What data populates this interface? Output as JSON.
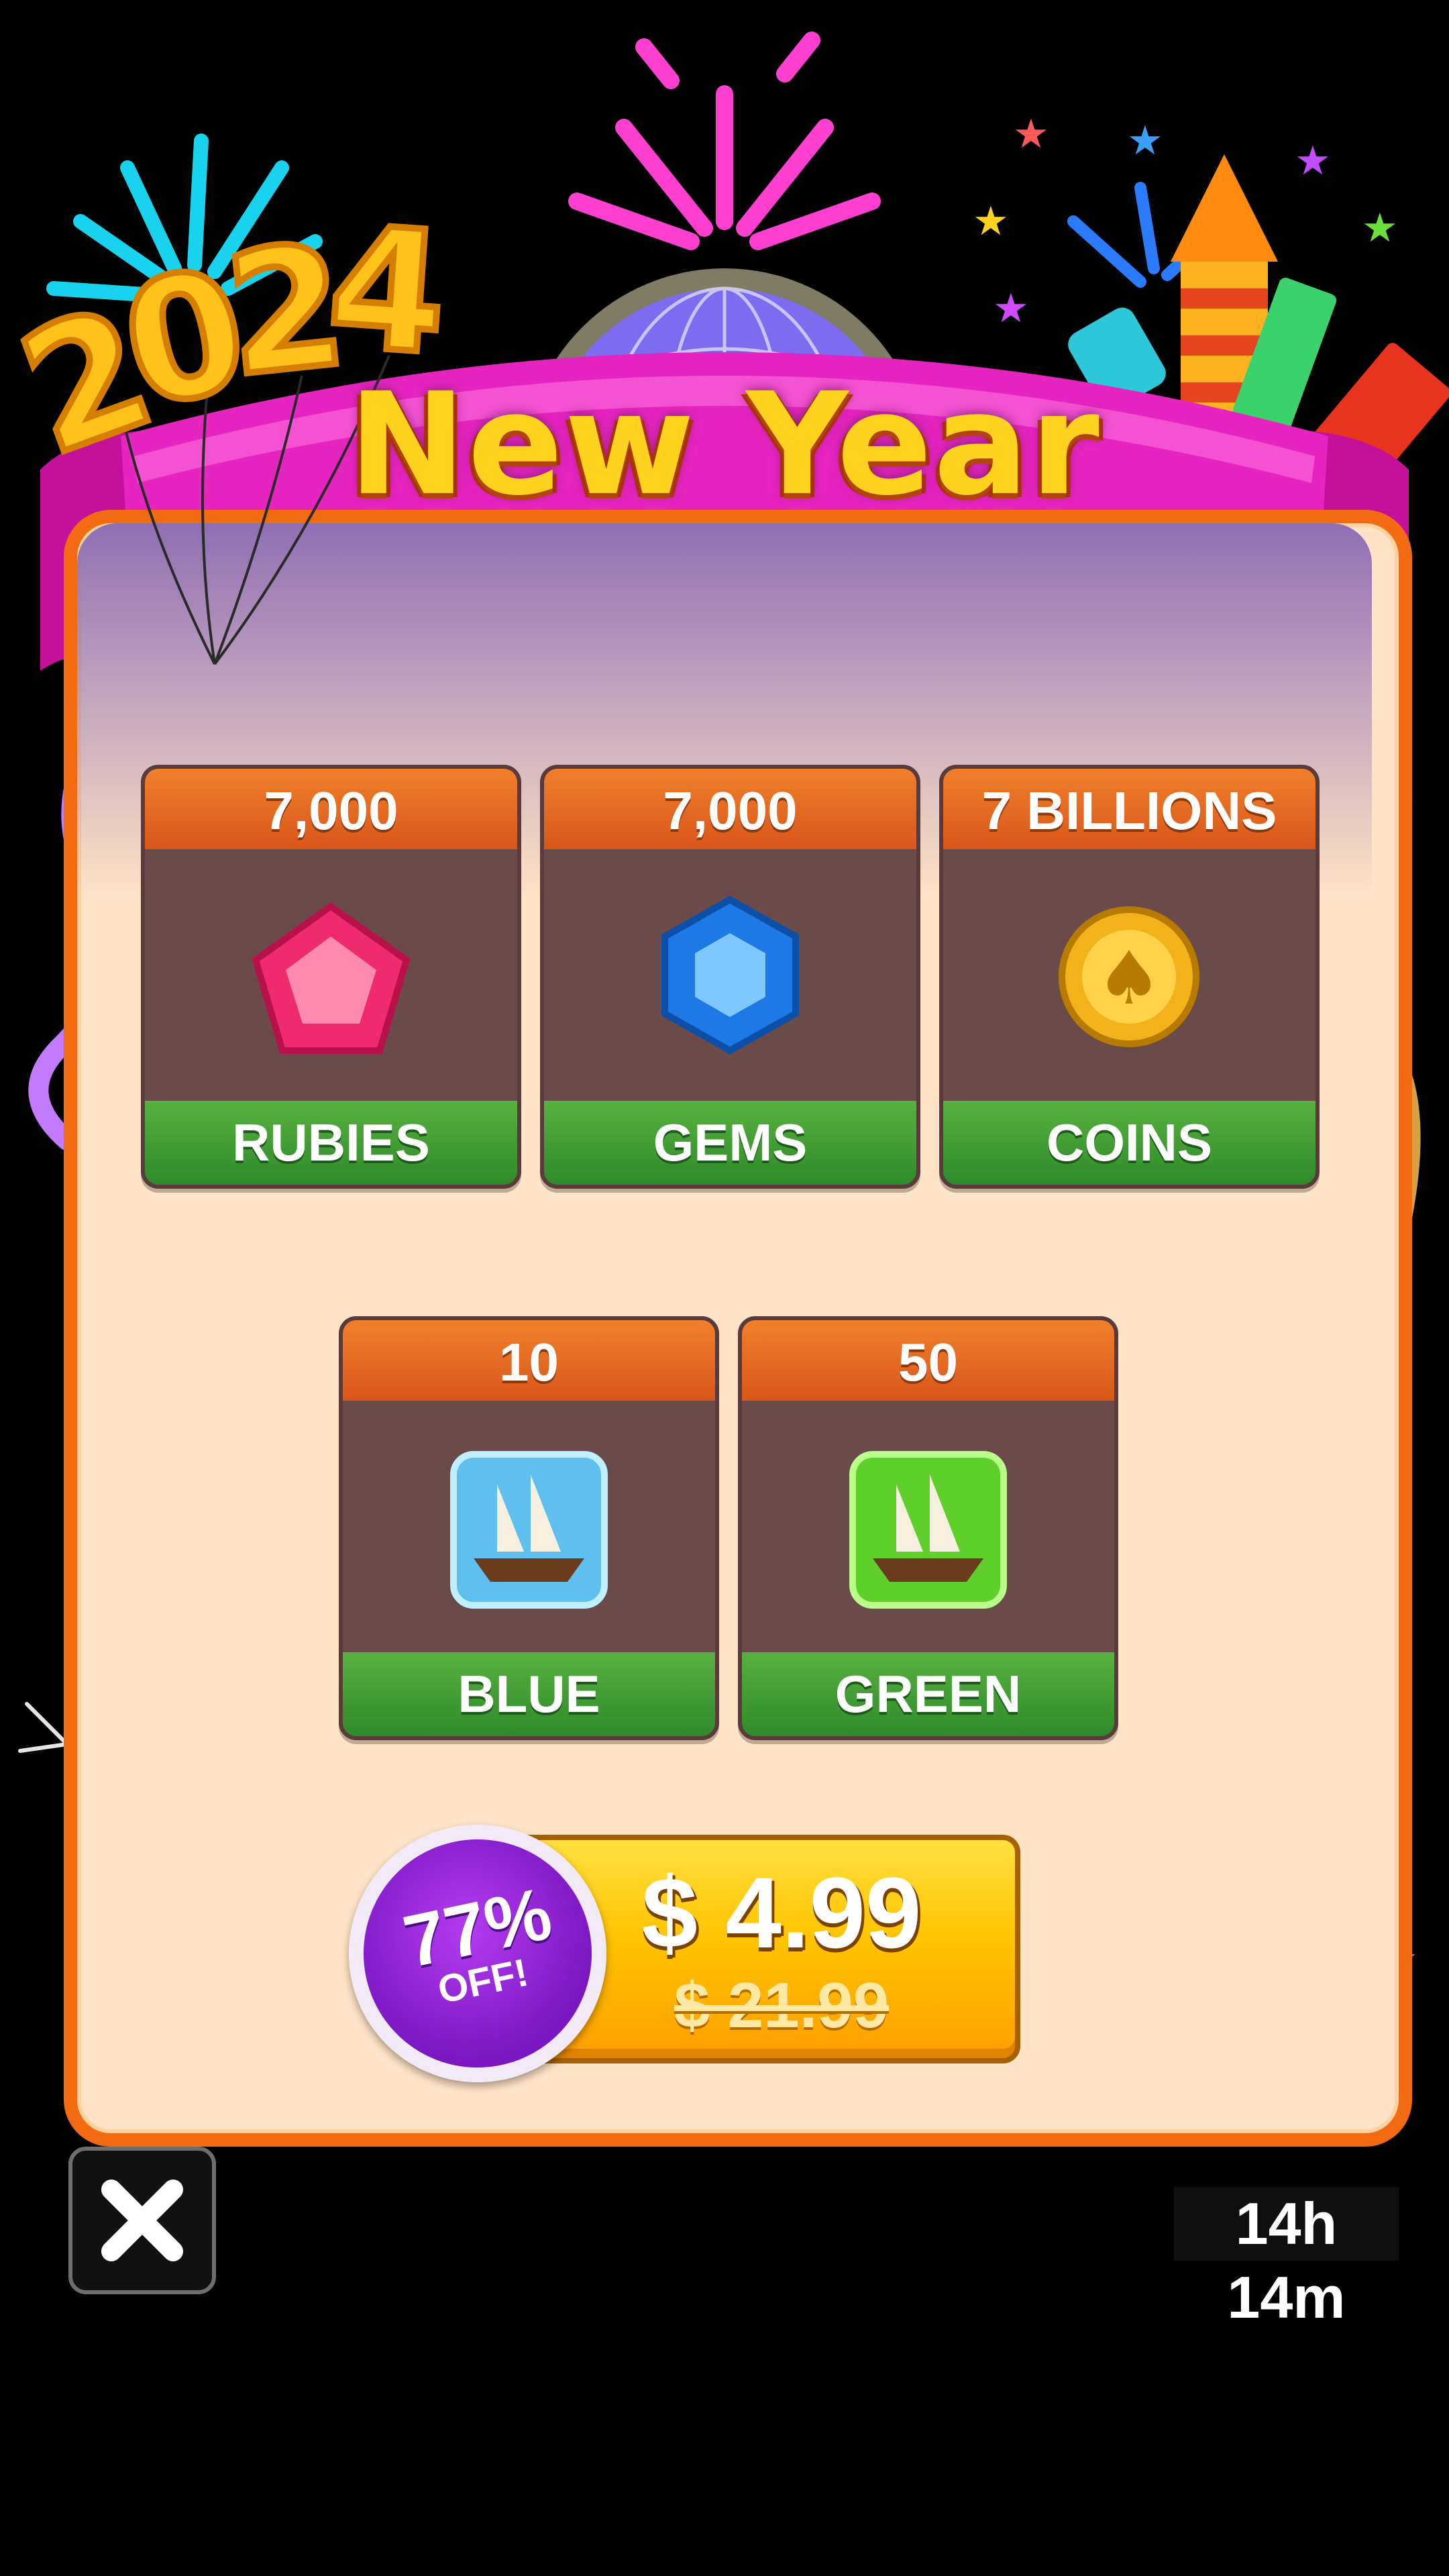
{
  "banner": {
    "title": "New Year",
    "year_balloons": "2024"
  },
  "rewards_row1": [
    {
      "amount": "7,000",
      "label": "RUBIES",
      "icon": "ruby-icon"
    },
    {
      "amount": "7,000",
      "label": "GEMS",
      "icon": "gem-icon"
    },
    {
      "amount": "7 BILLIONS",
      "label": "COINS",
      "icon": "coin-icon"
    }
  ],
  "rewards_row2": [
    {
      "amount": "10",
      "label": "BLUE GALLEON",
      "icon": "blue-galleon-icon"
    },
    {
      "amount": "50",
      "label": "GREEN GALLEON",
      "icon": "green-galleon-icon"
    }
  ],
  "offer": {
    "discount": "77%",
    "discount_suffix": "OFF!",
    "price": "$ 4.99",
    "old_price": "$ 21.99"
  },
  "timer": {
    "text": "14h 14m"
  },
  "colors": {
    "panel_border": "#f26b12",
    "panel_bg": "#fee4c6",
    "card_header": "#e66a1f",
    "card_footer": "#3f9a33",
    "banner": "#e21fb7",
    "badge": "#8a22cf",
    "price_button": "#ffc400"
  }
}
